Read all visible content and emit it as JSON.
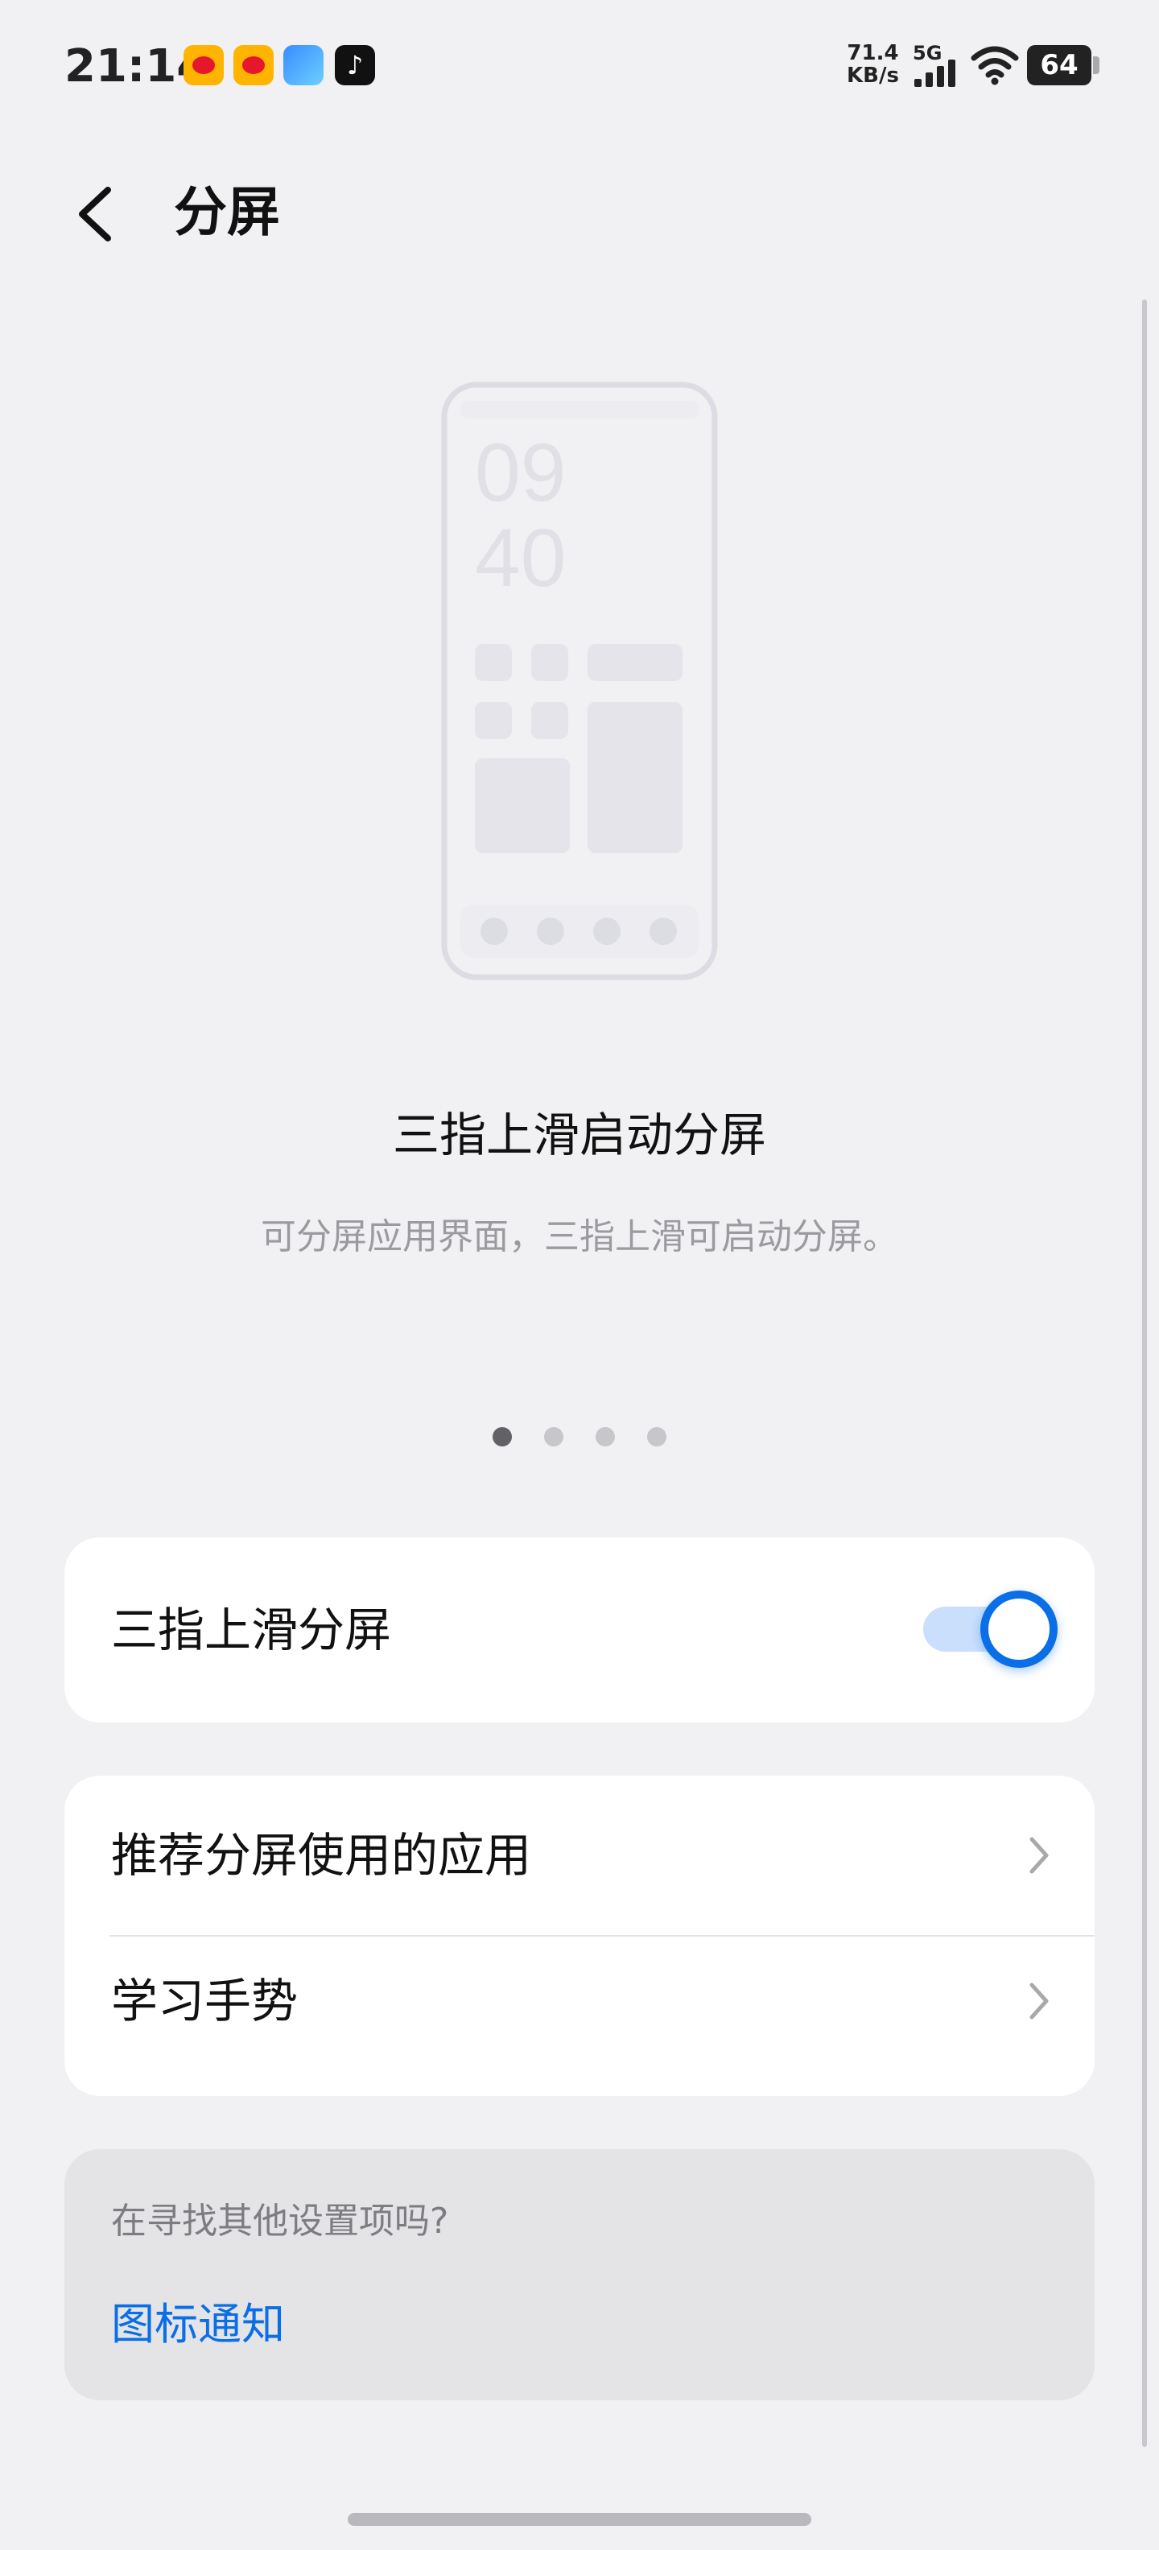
{
  "status_bar": {
    "time": "21:14",
    "app_icons": [
      "weibo-icon",
      "weibo-icon",
      "app-icon",
      "tiktok-icon"
    ],
    "net_speed_value": "71.4",
    "net_speed_unit": "KB/s",
    "network_gen": "5G",
    "battery": "64"
  },
  "header": {
    "back_icon": "chevron-left-icon",
    "title": "分屏"
  },
  "illustration": {
    "clock_hour": "09",
    "clock_minute": "40"
  },
  "slide": {
    "title": "三指上滑启动分屏",
    "description": "可分屏应用界面，三指上滑可启动分屏。",
    "page_count": 4,
    "active_page": 1
  },
  "toggle_card": {
    "label": "三指上滑分屏",
    "enabled": true
  },
  "nav_card": {
    "items": [
      {
        "label": "推荐分屏使用的应用"
      },
      {
        "label": "学习手势"
      }
    ]
  },
  "suggestion": {
    "prompt": "在寻找其他设置项吗?",
    "link": "图标通知"
  },
  "colors": {
    "accent": "#0a6ee6",
    "background": "#f1f1f3",
    "card": "#ffffff"
  }
}
